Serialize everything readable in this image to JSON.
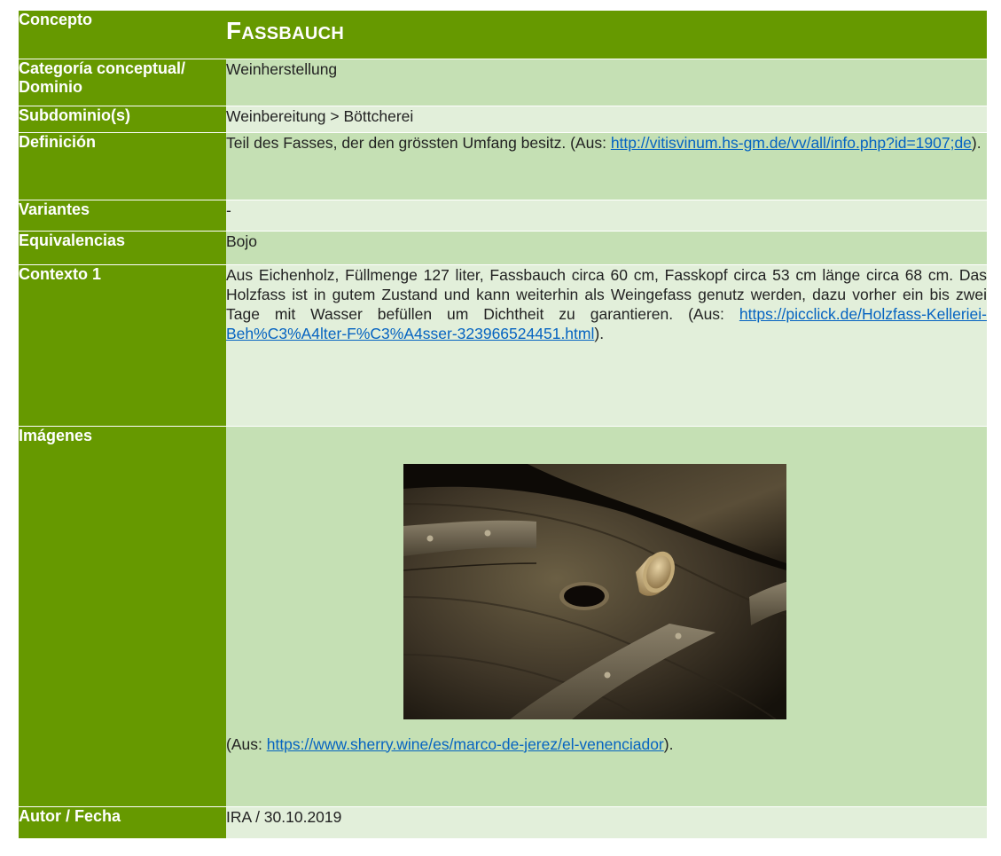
{
  "rows": {
    "concepto": {
      "label": "Concepto",
      "title_initial": "F",
      "title_rest": "ASSBAUCH"
    },
    "categoria": {
      "label": "Categoría conceptual/ Dominio",
      "value": "Weinherstellung"
    },
    "subdominio": {
      "label": "Subdominio(s)",
      "value": "Weinbereitung > Böttcherei"
    },
    "definicion": {
      "label": "Definición",
      "text": "Teil des Fasses, der den grössten Umfang besitz. (Aus: ",
      "link": "http://vitisvinum.hs-gm.de/vv/all/info.php?id=1907;de",
      "suffix": ")."
    },
    "variantes": {
      "label": "Variantes",
      "value": "-"
    },
    "equivalencias": {
      "label": "Equivalencias",
      "value": "Bojo"
    },
    "contexto": {
      "label": "Contexto 1",
      "text": "Aus Eichenholz, Füllmenge 127 liter, Fassbauch circa 60 cm, Fasskopf circa 53 cm länge circa 68 cm. Das Holzfass ist in gutem Zustand und kann weiterhin als Weingefass genutz werden, dazu vorher ein bis zwei Tage mit Wasser befüllen um Dichtheit zu garantieren. (Aus: ",
      "link": "https://picclick.de/Holzfass-Kelleriei-Beh%C3%A4lter-F%C3%A4sser-323966524451.html",
      "suffix": ")."
    },
    "imagenes": {
      "label": "Imágenes",
      "caption_prefix": "(Aus: ",
      "caption_link": "https://www.sherry.wine/es/marco-de-jerez/el-venenciador",
      "caption_suffix": ")."
    },
    "autor": {
      "label": "Autor / Fecha",
      "value": "IRA / 30.10.2019"
    }
  },
  "colors": {
    "label_green": "#669900",
    "value_light": "#c5e0b4",
    "value_lighter": "#e2efda",
    "link": "#0563c1"
  }
}
